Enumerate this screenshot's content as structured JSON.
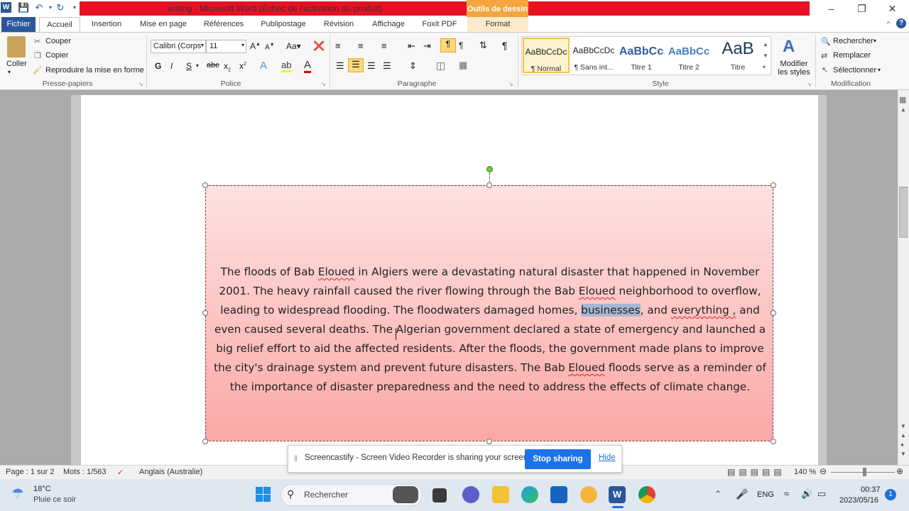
{
  "window": {
    "title": "writing  -  Microsoft Word (Échec de l'activation du produit)",
    "contextual_tab_group": "Outils de dessin"
  },
  "tabs": [
    "Fichier",
    "Accueil",
    "Insertion",
    "Mise en page",
    "Références",
    "Publipostage",
    "Révision",
    "Affichage",
    "Foxit PDF",
    "Format"
  ],
  "ribbon": {
    "clipboard": {
      "paste": "Coller",
      "cut": "Couper",
      "copy": "Copier",
      "format_painter": "Reproduire la mise en forme",
      "label": "Presse-papiers"
    },
    "font": {
      "name": "Calibri (Corps",
      "size": "11",
      "bold": "G",
      "italic": "I",
      "underline": "S",
      "label": "Police"
    },
    "paragraph": {
      "label": "Paragraphe"
    },
    "styles": {
      "items": [
        {
          "preview": "AaBbCcDc",
          "name": "¶ Normal"
        },
        {
          "preview": "AaBbCcDc",
          "name": "¶ Sans int..."
        },
        {
          "preview": "AaBbCc",
          "name": "Titre 1"
        },
        {
          "preview": "AaBbCc",
          "name": "Titre 2"
        },
        {
          "preview": "AaB",
          "name": "Titre"
        }
      ],
      "change_styles": "Modifier les styles",
      "label": "Style"
    },
    "editing": {
      "find": "Rechercher",
      "replace": "Remplacer",
      "select": "Sélectionner",
      "label": "Modification"
    }
  },
  "document": {
    "textbox_segments": [
      {
        "text": "The floods of Bab ",
        "style": ""
      },
      {
        "text": "Eloued",
        "style": "squig"
      },
      {
        "text": " in Algiers were a devastating natural disaster that happened in November 2001. The heavy rainfall caused the river flowing through the Bab ",
        "style": ""
      },
      {
        "text": "Eloued",
        "style": "squig"
      },
      {
        "text": " neighborhood to overflow, leading to widespread flooding. The floodwaters damaged homes, ",
        "style": ""
      },
      {
        "text": "businesses",
        "style": "hl"
      },
      {
        "text": ", and ",
        "style": ""
      },
      {
        "text": "everything ,",
        "style": "squig"
      },
      {
        "text": " and even caused several deaths. The Algerian government declared a state of emergency and launched a big relief effort to aid the affected residents. After the floods, the government made plans to improve the city's drainage system and prevent future disasters. The Bab ",
        "style": ""
      },
      {
        "text": "Eloued",
        "style": "squig"
      },
      {
        "text": " floods serve as a reminder of the importance of disaster preparedness and the need to address the effects of climate change.",
        "style": ""
      }
    ]
  },
  "statusbar": {
    "page": "Page : 1 sur 2",
    "words": "Mots : 1/563",
    "language": "Anglais (Australie)",
    "zoom": "140 %"
  },
  "share_banner": {
    "text": "Screencastify - Screen Video Recorder is sharing your screen.",
    "stop": "Stop sharing",
    "hide": "Hide"
  },
  "taskbar": {
    "temp": "18°C",
    "weather": "Pluie ce soir",
    "search": "Rechercher",
    "lang": "ENG",
    "time": "00:37",
    "date": "2023/05/16",
    "notifications": "1"
  }
}
